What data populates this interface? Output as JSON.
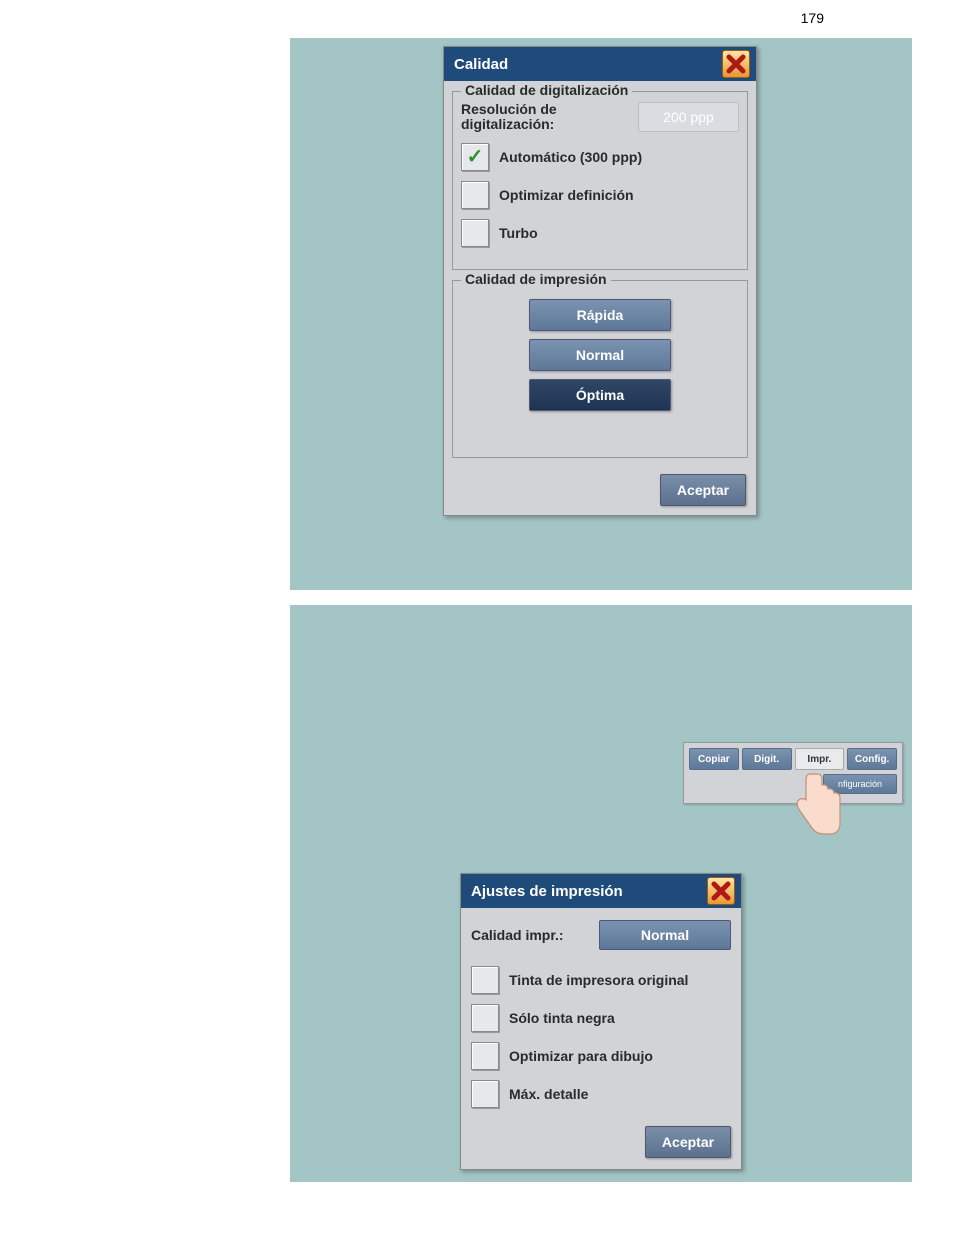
{
  "page_number": "179",
  "dialog1": {
    "title": "Calidad",
    "scan_quality": {
      "legend": "Calidad de digitalización",
      "resolution_label": "Resolución de digitalización:",
      "resolution_value": "200 ppp",
      "options": [
        {
          "label": "Automático (300 ppp)",
          "checked": true
        },
        {
          "label": "Optimizar definición",
          "checked": false
        },
        {
          "label": "Turbo",
          "checked": false
        }
      ]
    },
    "print_quality": {
      "legend": "Calidad de impresión",
      "buttons": [
        "Rápida",
        "Normal",
        "Óptima"
      ]
    },
    "accept": "Aceptar"
  },
  "toolbar": {
    "tabs": [
      "Copiar",
      "Digit.",
      "Impr.",
      "Config."
    ],
    "sub_button": "nfiguración"
  },
  "dialog2": {
    "title": "Ajustes de impresión",
    "quality_label": "Calidad impr.:",
    "quality_value": "Normal",
    "options": [
      {
        "label": "Tinta de impresora original",
        "checked": false
      },
      {
        "label": "Sólo tinta negra",
        "checked": false
      },
      {
        "label": "Optimizar para dibujo",
        "checked": false
      },
      {
        "label": "Máx. detalle",
        "checked": false
      }
    ],
    "accept": "Aceptar"
  }
}
